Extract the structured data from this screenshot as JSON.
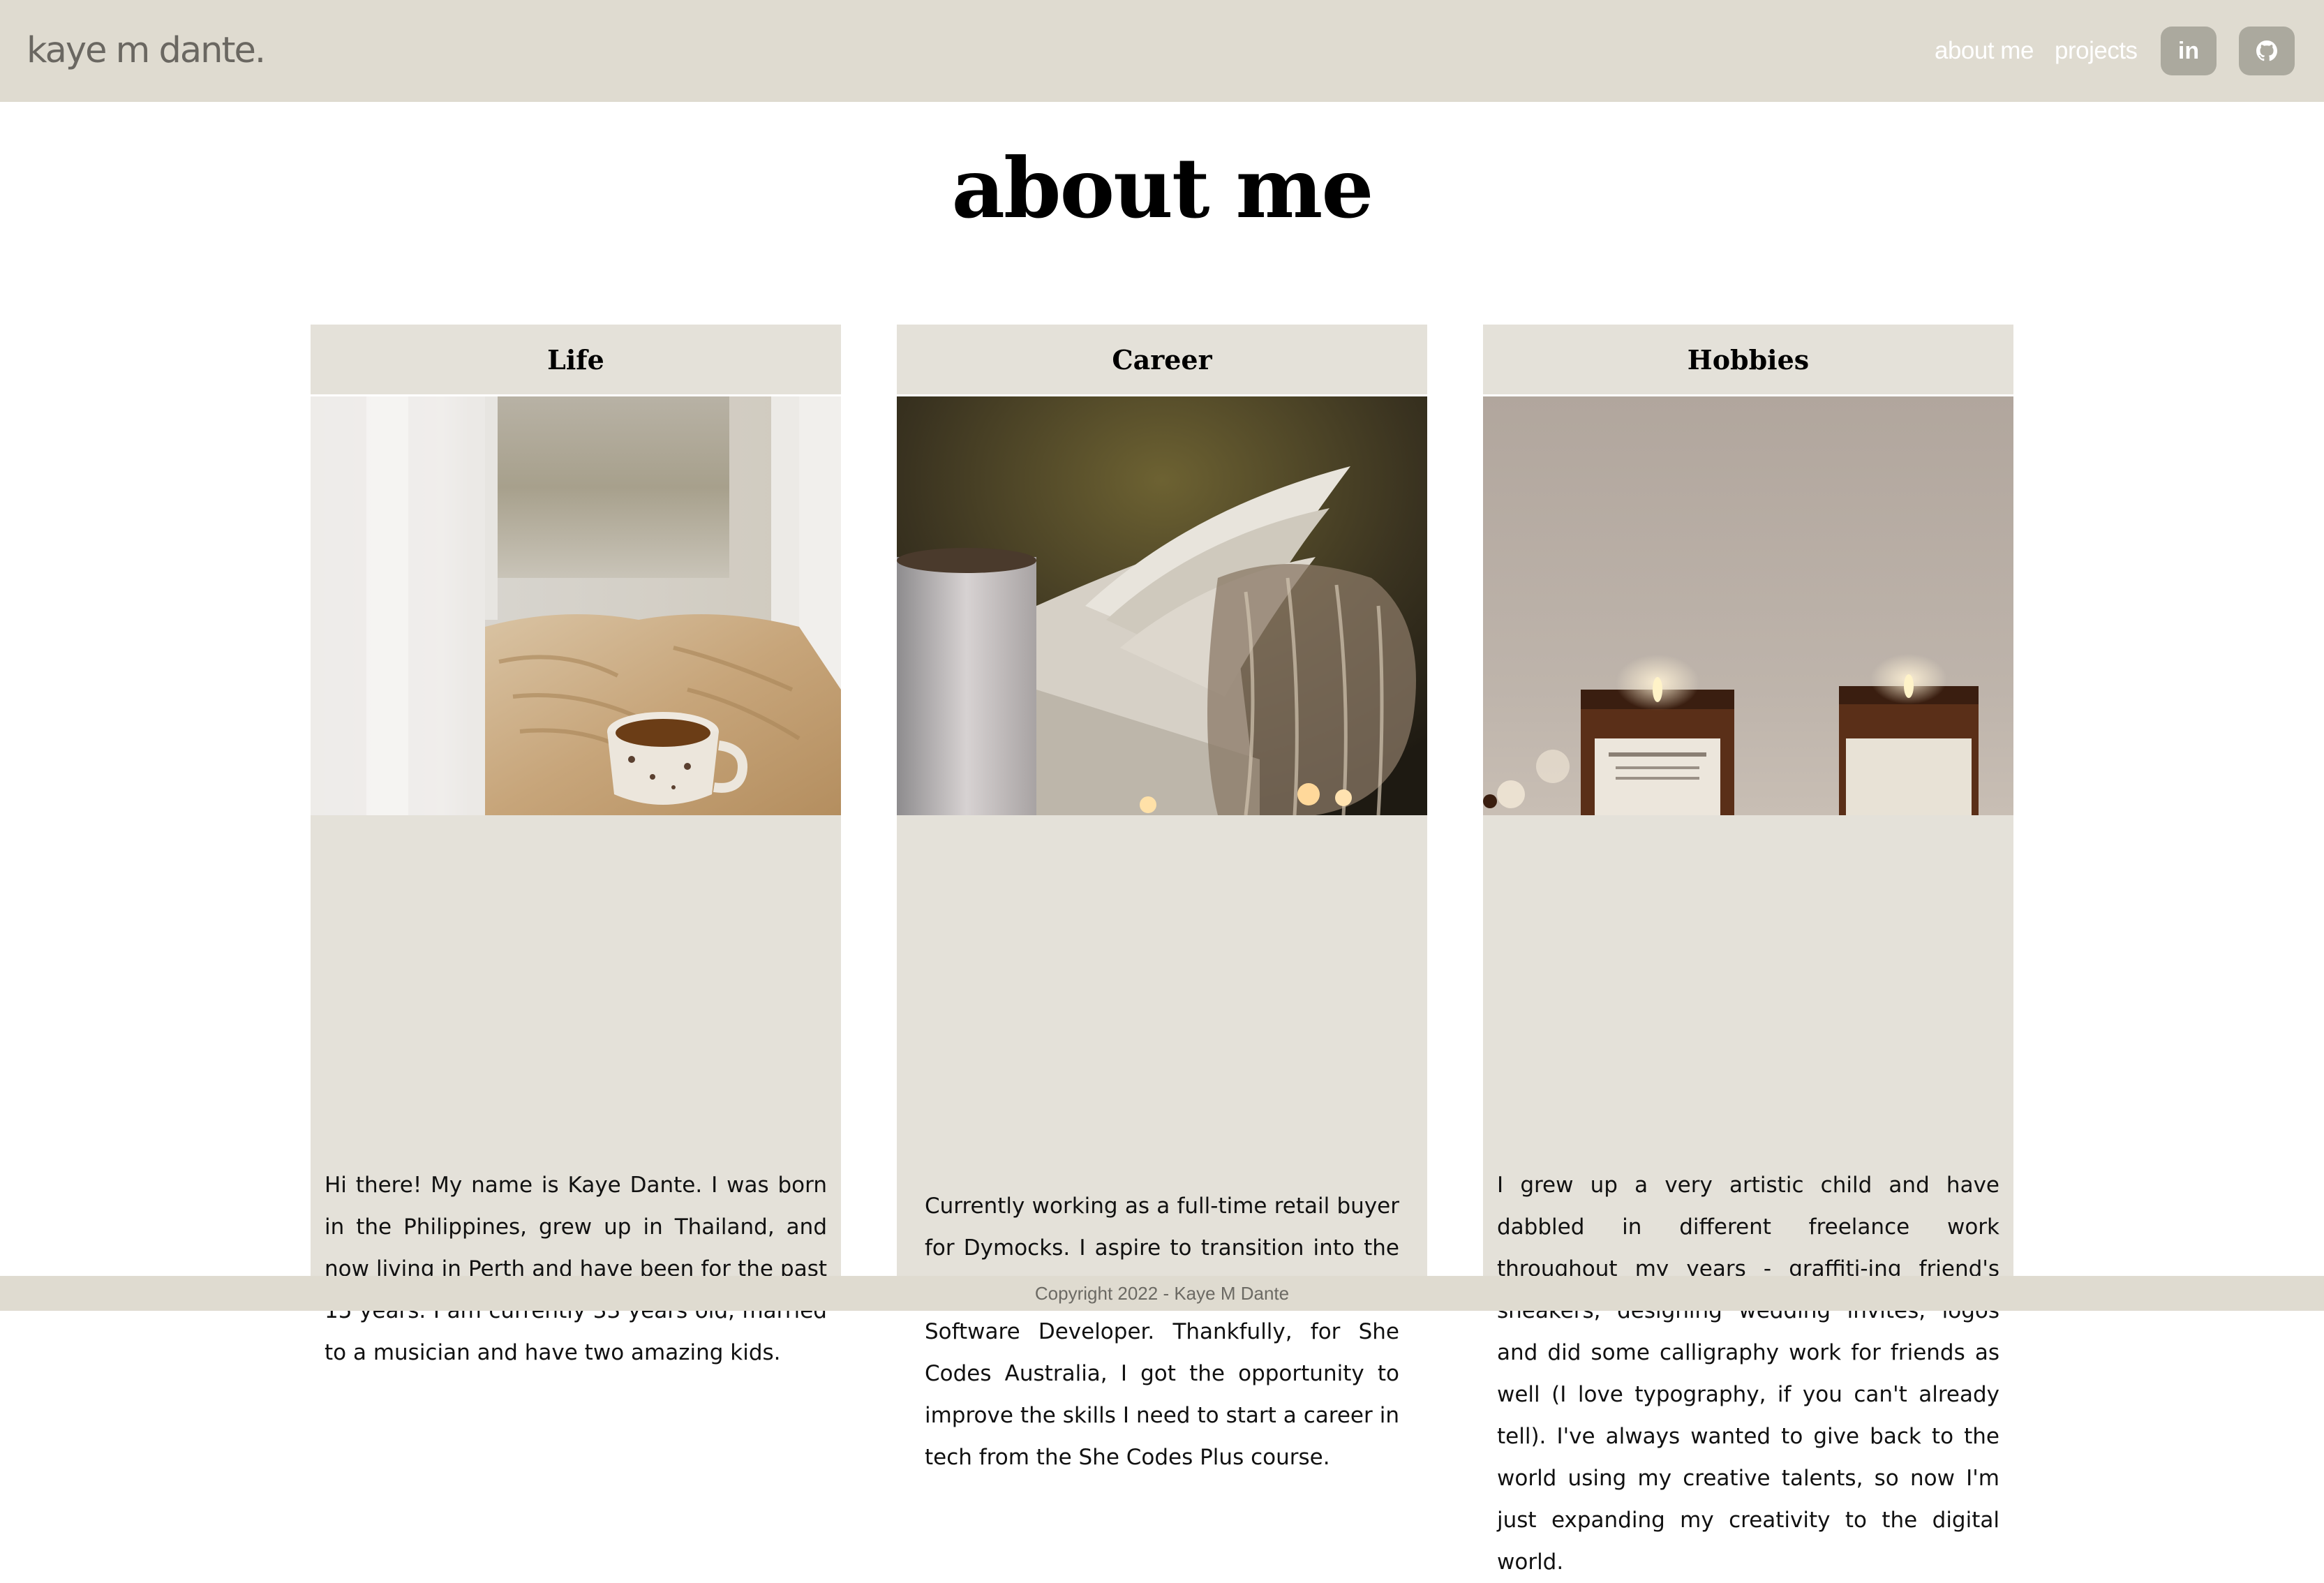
{
  "navbar": {
    "brand": "kaye m dante.",
    "links": [
      {
        "label": "about me"
      },
      {
        "label": "projects"
      }
    ],
    "social": [
      {
        "label": "in",
        "icon": "linkedin-icon"
      },
      {
        "icon": "github-icon"
      }
    ],
    "background": "#dfdbd0",
    "button_color": "#aba99e"
  },
  "main": {
    "title": "about me",
    "cards": [
      {
        "title": "Life",
        "image": "cozy-window-tea-icon",
        "text": "Hi there! My name is Kaye Dante. I was born in the Philippines, grew up in Thailand, and now living in Perth and have been for the past 15 years. I am currently 33 years old, married to a musician and have two amazing kids."
      },
      {
        "title": "Career",
        "image": "book-candle-icon",
        "text": "Currently working as a full-time retail buyer for Dymocks. I aspire to transition into the tech industry as a Front End Developer / Software Developer. Thankfully, for She Codes Australia, I got the opportunity to improve the skills I need to start a career in tech from the She Codes Plus course."
      },
      {
        "title": "Hobbies",
        "image": "candles-icon",
        "text": "I grew up a very artistic child and have dabbled in different freelance work throughout my years - graffiti-ing friend's sneakers, designing wedding invites, logos and did some calligraphy work for friends as well (I love typography, if you can't already tell). I've always wanted to give back to the world using my creative talents, so now I'm just expanding my creativity to the digital world."
      }
    ],
    "card_background": "#e4e1d9"
  },
  "footer": {
    "text": "Copyright 2022 - Kaye M Dante"
  }
}
